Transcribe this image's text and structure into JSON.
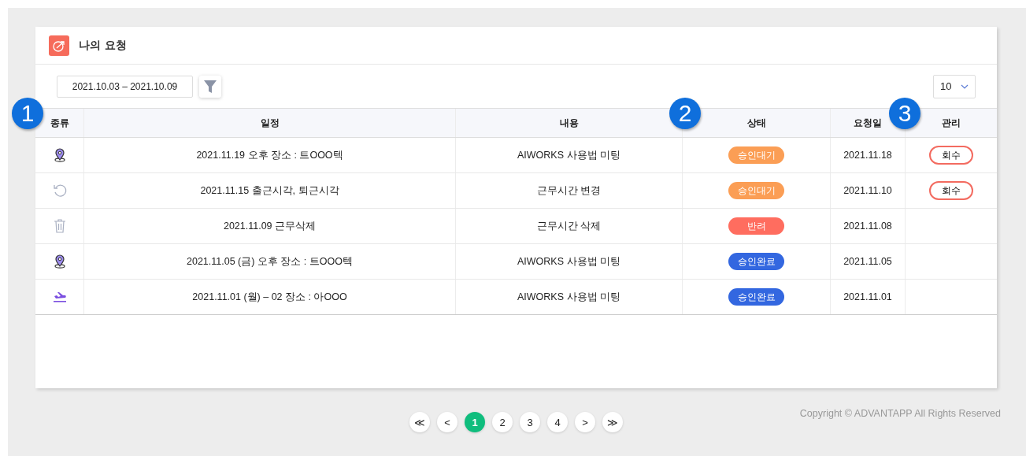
{
  "header": {
    "title": "나의 요청"
  },
  "toolbar": {
    "date_range": "2021.10.03 – 2021.10.09",
    "page_size": "10"
  },
  "markers": [
    "1",
    "2",
    "3"
  ],
  "table": {
    "columns": [
      "종류",
      "일정",
      "내용",
      "상태",
      "요청일",
      "관리"
    ],
    "rows": [
      {
        "kind": "location",
        "schedule": "2021.11.19 오후 장소 : 트OOO텍",
        "content": "AIWORKS 사용법 미팅",
        "status": {
          "text": "승인대기",
          "color": "#fb9e55"
        },
        "date": "2021.11.18",
        "action": "회수"
      },
      {
        "kind": "undo",
        "schedule": "2021.11.15 출근시각, 퇴근시각",
        "content": "근무시간 변경",
        "status": {
          "text": "승인대기",
          "color": "#fb9e55"
        },
        "date": "2021.11.10",
        "action": "회수"
      },
      {
        "kind": "trash",
        "schedule": "2021.11.09  근무삭제",
        "content": "근무시간 삭제",
        "status": {
          "text": "반려",
          "color": "#ff6d5f"
        },
        "date": "2021.11.08"
      },
      {
        "kind": "location",
        "schedule": "2021.11.05 (금) 오후 장소 : 트OOO텍",
        "content": "AIWORKS 사용법 미팅",
        "status": {
          "text": "승인완료",
          "color": "#3367e0"
        },
        "date": "2021.11.05"
      },
      {
        "kind": "flight",
        "schedule": "2021.11.01 (월) – 02  장소 : 아OOO",
        "content": "AIWORKS 사용법 미팅",
        "status": {
          "text": "승인완료",
          "color": "#3367e0"
        },
        "date": "2021.11.01"
      }
    ]
  },
  "pagination": {
    "first": "≪",
    "prev": "<",
    "pages": [
      {
        "label": "1",
        "selected": true
      },
      {
        "label": "2",
        "selected": false
      },
      {
        "label": "3",
        "selected": false
      },
      {
        "label": "4",
        "selected": false
      }
    ],
    "next": ">",
    "last": "≫"
  },
  "footer": {
    "copyright": "Copyright © ADVANTAPP All Rights Reserved"
  }
}
